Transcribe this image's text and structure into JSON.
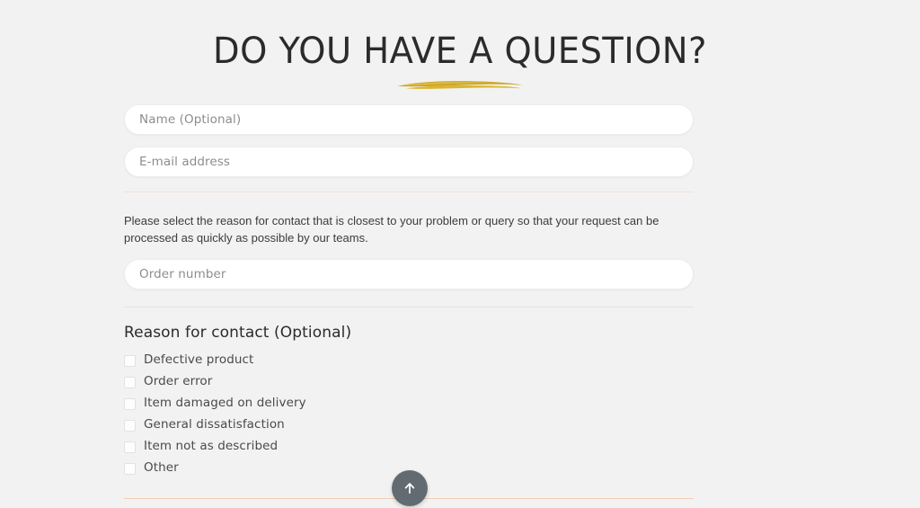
{
  "page": {
    "background_color": "#f2f2f2",
    "title": "DO YOU HAVE A QUESTION?",
    "underline_color": "#d4af37"
  },
  "form": {
    "name_field": {
      "placeholder": "Name (Optional)",
      "value": ""
    },
    "email_field": {
      "placeholder": "E-mail address",
      "value": ""
    },
    "order_field": {
      "placeholder": "Order number",
      "value": ""
    },
    "intro_text": "Please select the reason for contact that is closest to your problem or query so that your request can be processed as quickly as possible by our teams.",
    "reason_heading": "Reason for contact (Optional)",
    "reason_options": [
      {
        "label": "Defective product",
        "checked": false
      },
      {
        "label": "Order error",
        "checked": false
      },
      {
        "label": "Item damaged on delivery",
        "checked": false
      },
      {
        "label": "General dissatisfaction",
        "checked": false
      },
      {
        "label": "Item not as described",
        "checked": false
      },
      {
        "label": "Other",
        "checked": false
      }
    ]
  },
  "dividers": {
    "top_color": "#f2e1db",
    "middle_color": "#eae0d4",
    "bottom_color": "#f0cdb2"
  },
  "scroll_top_button": {
    "icon": "arrow-up-icon",
    "color": "#636b72"
  }
}
